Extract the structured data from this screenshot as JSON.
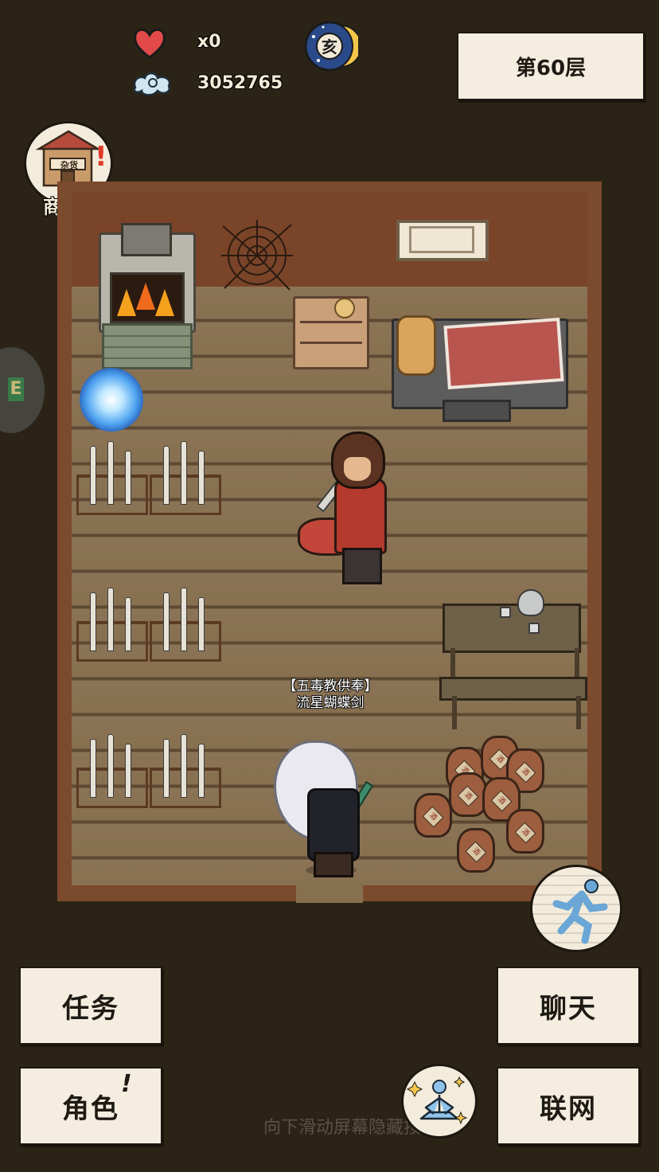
{
  "hud": {
    "lives_text": "x0",
    "currency_value": "3052765",
    "zodiac_glyph": "亥",
    "floor_label": "第60层",
    "colors": {
      "heart": "#e24a4a",
      "moon": "#2b4a8a",
      "panel": "#f4ede0"
    }
  },
  "shop": {
    "label": "商城",
    "sign_text": "杂货",
    "alert": "!"
  },
  "side_tab": {
    "text": "E"
  },
  "npc": {
    "title": "【五毒教供奉】",
    "name": "流星蝴蝶剑"
  },
  "room": {
    "jar_text": "酒"
  },
  "buttons": {
    "tasks": "任务",
    "chat": "聊天",
    "character": "角色",
    "character_alert": "!",
    "network": "联网"
  },
  "hint": "向下滑动屏幕隐藏按",
  "icons": {
    "lives": "heart-icon",
    "currency": "cloud-swirl-icon",
    "time": "moon-zodiac-icon",
    "run": "running-figure-icon",
    "meditate": "meditating-figure-icon"
  }
}
